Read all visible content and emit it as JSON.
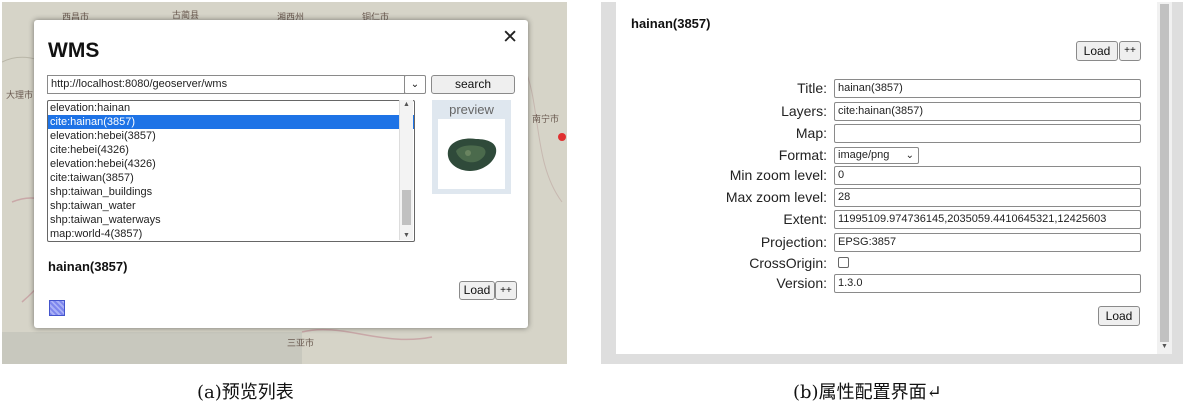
{
  "panel_a": {
    "map_labels": [
      "西昌市",
      "古蔺县",
      "湘西州",
      "铜仁市",
      "大理市",
      "南宁市",
      "三亚市"
    ],
    "dialog": {
      "title": "WMS",
      "close_icon": "close-icon",
      "url_value": "http://localhost:8080/geoserver/wms",
      "url_dropdown_icon": "chevron-down-icon",
      "search_label": "search",
      "layers": [
        "elevation:hainan",
        "cite:hainan(3857)",
        "elevation:hebei(3857)",
        "cite:hebei(4326)",
        "elevation:hebei(4326)",
        "cite:taiwan(3857)",
        "shp:taiwan_buildings",
        "shp:taiwan_water",
        "shp:taiwan_waterways",
        "map:world-4(3857)"
      ],
      "selected_layer_index": 1,
      "preview_label": "preview",
      "selected_title": "hainan(3857)",
      "load_label": "Load",
      "more_label": "++",
      "swatch_color": "#7d86ee"
    }
  },
  "panel_b": {
    "title": "hainan(3857)",
    "load_label": "Load",
    "more_label": "++",
    "fields": {
      "title": {
        "label": "Title:",
        "value": "hainan(3857)"
      },
      "layers": {
        "label": "Layers:",
        "value": "cite:hainan(3857)"
      },
      "map": {
        "label": "Map:",
        "value": ""
      },
      "format": {
        "label": "Format:",
        "value": "image/png"
      },
      "min_zoom": {
        "label": "Min zoom level:",
        "value": "0"
      },
      "max_zoom": {
        "label": "Max zoom level:",
        "value": "28"
      },
      "extent": {
        "label": "Extent:",
        "value": "11995109.974736145,2035059.4410645321,12425603"
      },
      "projection": {
        "label": "Projection:",
        "value": "EPSG:3857"
      },
      "crossorigin": {
        "label": "CrossOrigin:",
        "checked": false
      },
      "version": {
        "label": "Version:",
        "value": "1.3.0"
      }
    },
    "bottom_load_label": "Load"
  },
  "captions": {
    "a": "(a)预览列表",
    "b": "(b)属性配置界面↵"
  }
}
